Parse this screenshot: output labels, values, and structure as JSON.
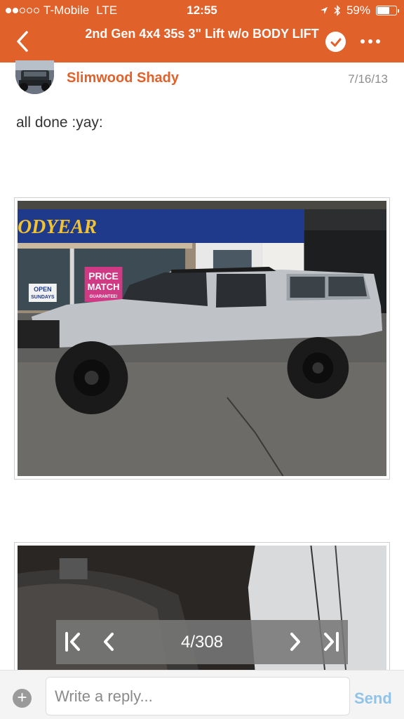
{
  "status_bar": {
    "carrier": "T-Mobile",
    "network": "LTE",
    "time": "12:55",
    "battery": "59%",
    "battery_level": 0.59,
    "icons": [
      "location-arrow-icon",
      "bluetooth-icon",
      "battery-icon"
    ]
  },
  "header": {
    "title": "2nd Gen 4x4 35s 3\" Lift w/o BODY LIFT",
    "back_icon": "chevron-left-icon",
    "check_icon": "checkmark-icon",
    "more_icon": "ellipsis-icon",
    "accent_color": "#e0612a"
  },
  "post": {
    "author": "Slimwood Shady",
    "date": "7/16/13",
    "text": "all done :yay:",
    "images": [
      {
        "signs": {
          "store": "ODYEAR",
          "price_line1": "PRICE",
          "price_line2": "MATCH",
          "price_line3": "GUARANTEE!",
          "open_line1": "OPEN",
          "open_line2": "SUNDAYS"
        }
      },
      {}
    ]
  },
  "pager": {
    "label": "4/308",
    "icons": [
      "first-page-icon",
      "previous-page-icon",
      "next-page-icon",
      "last-page-icon"
    ]
  },
  "reply": {
    "placeholder": "Write a reply...",
    "send_label": "Send",
    "plus_icon": "plus-icon",
    "send_color": "#8fc4e8"
  }
}
